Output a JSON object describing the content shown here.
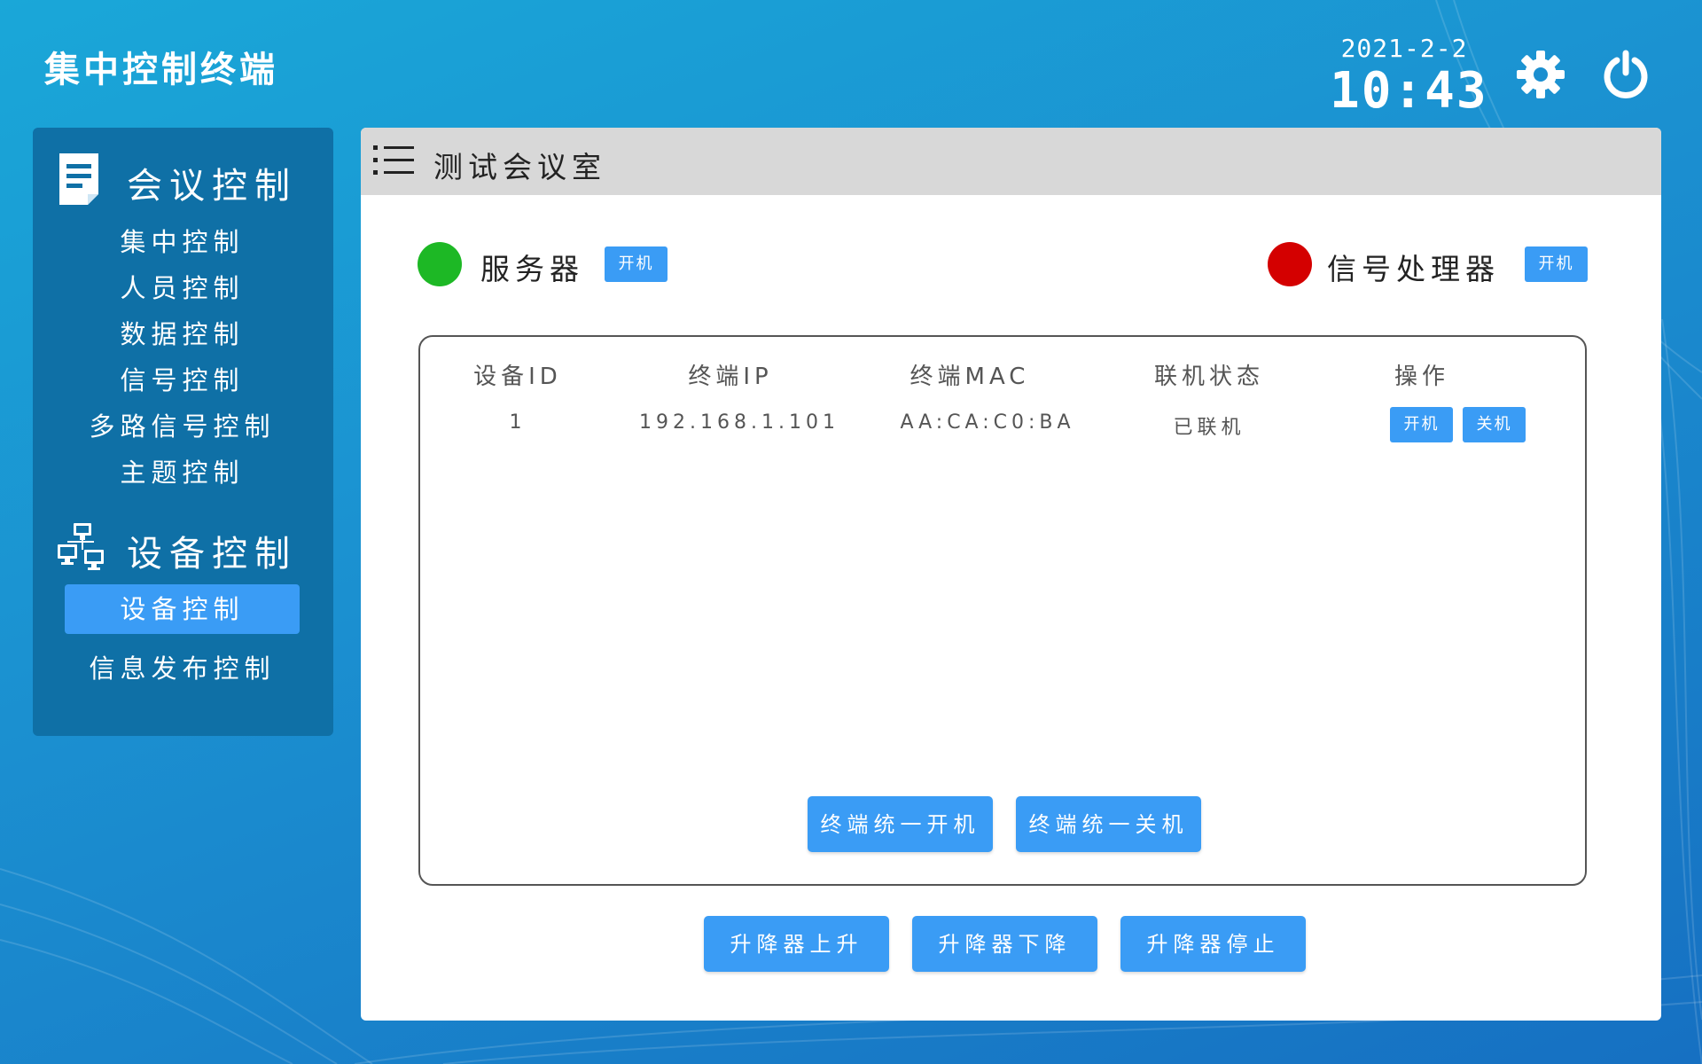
{
  "header": {
    "app_title": "集中控制终端",
    "date": "2021-2-2",
    "time": "10:43",
    "settings_icon": "gear-icon",
    "power_icon": "power-icon"
  },
  "sidebar": {
    "sections": [
      {
        "title": "会议控制",
        "icon": "document-icon",
        "items": [
          {
            "label": "集中控制",
            "active": false
          },
          {
            "label": "人员控制",
            "active": false
          },
          {
            "label": "数据控制",
            "active": false
          },
          {
            "label": "信号控制",
            "active": false
          },
          {
            "label": "多路信号控制",
            "active": false
          },
          {
            "label": "主题控制",
            "active": false
          }
        ]
      },
      {
        "title": "设备控制",
        "icon": "network-computers-icon",
        "items": [
          {
            "label": "设备控制",
            "active": true
          },
          {
            "label": "信息发布控制",
            "active": false
          }
        ]
      }
    ]
  },
  "main": {
    "room_title": "测试会议室",
    "menu_icon": "list-icon",
    "server": {
      "label": "服务器",
      "status_color": "#1db825",
      "button": "开机"
    },
    "processor": {
      "label": "信号处理器",
      "status_color": "#d40000",
      "button": "开机"
    },
    "table": {
      "columns": [
        "设备ID",
        "终端IP",
        "终端MAC",
        "联机状态",
        "操作"
      ],
      "rows": [
        {
          "id": "1",
          "ip": "192.168.1.101",
          "mac": "AA:CA:C0:BA",
          "status": "已联机",
          "actions": [
            "开机",
            "关机"
          ]
        }
      ]
    },
    "bulk_buttons": [
      "终端统一开机",
      "终端统一关机"
    ],
    "lift_buttons": [
      "升降器上升",
      "升降器下降",
      "升降器停止"
    ]
  },
  "colors": {
    "accent": "#3a9cf5",
    "sidebar_bg": "#0f70a6",
    "online": "#1db825",
    "offline": "#d40000"
  }
}
